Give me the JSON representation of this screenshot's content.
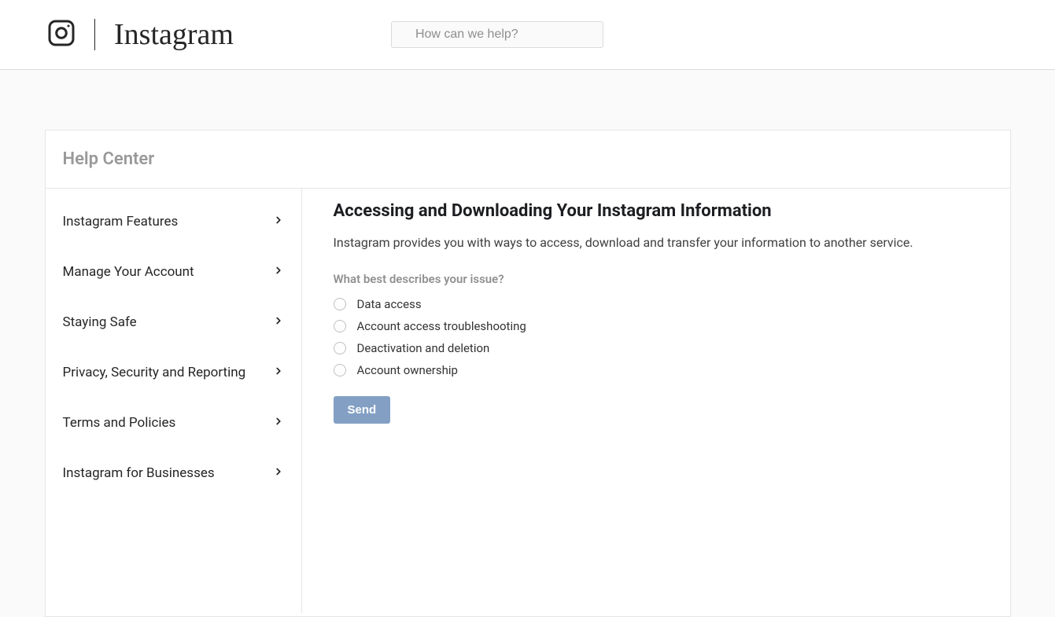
{
  "brand": "Instagram",
  "search": {
    "placeholder": "How can we help?"
  },
  "help_center": {
    "title": "Help Center"
  },
  "sidebar": {
    "items": [
      {
        "label": "Instagram Features"
      },
      {
        "label": "Manage Your Account"
      },
      {
        "label": "Staying Safe"
      },
      {
        "label": "Privacy, Security and Reporting"
      },
      {
        "label": "Terms and Policies"
      },
      {
        "label": "Instagram for Businesses"
      }
    ]
  },
  "main": {
    "title": "Accessing and Downloading Your Instagram Information",
    "intro": "Instagram provides you with ways to access, download and transfer your information to another service.",
    "question": "What best describes your issue?",
    "options": [
      {
        "label": "Data access"
      },
      {
        "label": "Account access troubleshooting"
      },
      {
        "label": "Deactivation and deletion"
      },
      {
        "label": "Account ownership"
      }
    ],
    "send_label": "Send"
  }
}
